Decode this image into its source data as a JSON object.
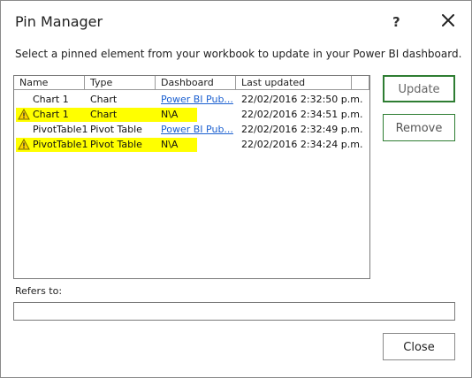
{
  "dialog": {
    "title": "Pin Manager",
    "help": "?",
    "instruction": "Select a pinned element from your workbook to update in your Power BI dashboard."
  },
  "list": {
    "columns": [
      "Name",
      "Type",
      "Dashboard",
      "Last updated"
    ],
    "rows": [
      {
        "name": "Chart 1",
        "type": "Chart",
        "dashboard": "Power BI Pub...",
        "updated": "22/02/2016 2:32:50 p.m.",
        "warning": false
      },
      {
        "name": "Chart 1",
        "type": "Chart",
        "dashboard": "N\\A",
        "updated": "22/02/2016 2:34:51 p.m.",
        "warning": true
      },
      {
        "name": "PivotTable1",
        "type": "Pivot Table",
        "dashboard": "Power BI Pub...",
        "updated": "22/02/2016 2:32:49 p.m.",
        "warning": false
      },
      {
        "name": "PivotTable1",
        "type": "Pivot Table",
        "dashboard": "N\\A",
        "updated": "22/02/2016 2:34:24 p.m.",
        "warning": true
      }
    ]
  },
  "buttons": {
    "update": "Update",
    "remove": "Remove",
    "close": "Close"
  },
  "refers": {
    "label": "Refers to:",
    "value": ""
  },
  "colors": {
    "highlight": "#ffff00",
    "link": "#1a5fd0",
    "button_border_accent": "#2e7d32"
  }
}
